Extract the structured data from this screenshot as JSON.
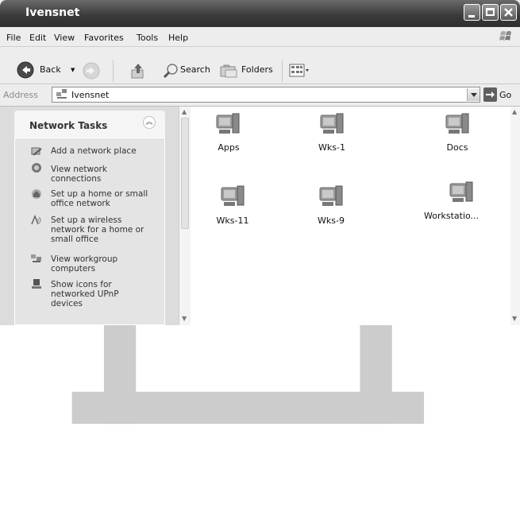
{
  "window": {
    "title": "Ivensnet"
  },
  "menu": [
    "File",
    "Edit",
    "View",
    "Favorites",
    "Tools",
    "Help"
  ],
  "toolbar": {
    "back_label": "Back",
    "search_label": "Search",
    "folders_label": "Folders"
  },
  "address": {
    "label": "Address",
    "value": "Ivensnet",
    "go_label": "Go"
  },
  "tasks": {
    "title": "Network Tasks",
    "items": [
      {
        "line1": "Add a network place",
        "line2": "",
        "line3": ""
      },
      {
        "line1": "View network",
        "line2": "connections",
        "line3": ""
      },
      {
        "line1": "Set up a home or small",
        "line2": "office network",
        "line3": ""
      },
      {
        "line1": "Set up a wireless",
        "line2": "network for a home or",
        "line3": "small office"
      },
      {
        "line1": "View workgroup",
        "line2": "computers",
        "line3": ""
      },
      {
        "line1": "Show icons for",
        "line2": "networked UPnP",
        "line3": "devices"
      }
    ]
  },
  "computers": [
    "Apps",
    "Wks-1",
    "Docs",
    "Wks-11",
    "Wks-9",
    "Workstatio..."
  ]
}
